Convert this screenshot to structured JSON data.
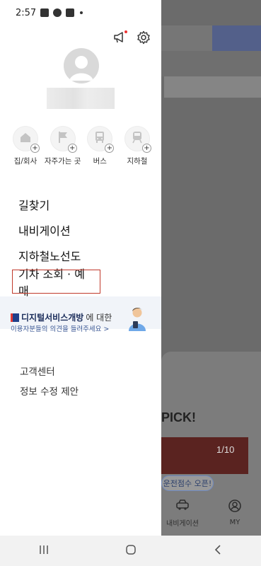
{
  "status": {
    "time": "2:57"
  },
  "drawer": {
    "shortcuts": [
      {
        "label": "집/회사",
        "icon": "home-icon"
      },
      {
        "label": "자주가는 곳",
        "icon": "flag-icon"
      },
      {
        "label": "버스",
        "icon": "bus-icon"
      },
      {
        "label": "지하철",
        "icon": "subway-icon"
      }
    ],
    "menu": [
      "길찾기",
      "내비게이션",
      "지하철노선도",
      "기차 조회 · 예매"
    ],
    "promo": {
      "brand": "디지털서비스개방",
      "suffix": "에 대한",
      "subtitle": "이용자분들의 의견을 들려주세요 >"
    },
    "links": [
      "고객센터",
      "정보 수정 제안"
    ]
  },
  "background": {
    "pick_text": "PICK!",
    "banner_counter": "1/10",
    "chip_text": "운전점수 오픈!",
    "tabs": [
      {
        "label": "내비게이션",
        "icon": "car-icon"
      },
      {
        "label": "MY",
        "icon": "profile-icon"
      }
    ]
  }
}
